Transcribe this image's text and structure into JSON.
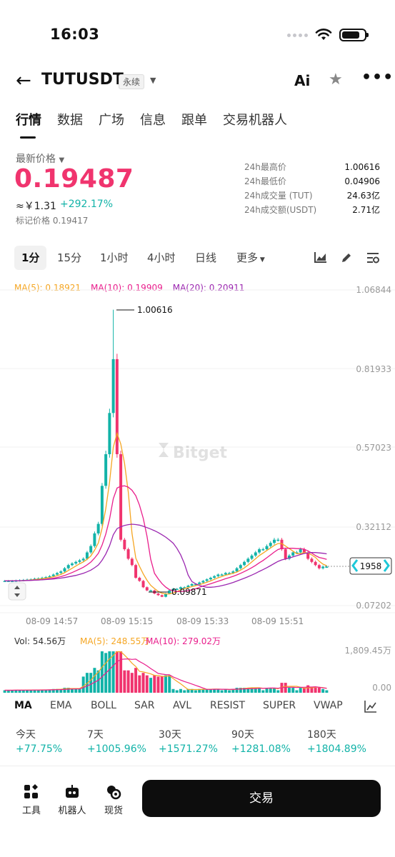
{
  "status": {
    "time": "16:03"
  },
  "header": {
    "pair": "TUTUSDT",
    "badge": "永续",
    "ai_label": "Ai"
  },
  "tabs": [
    "行情",
    "数据",
    "广场",
    "信息",
    "跟单",
    "交易机器人"
  ],
  "ticker": {
    "latest_label": "最新价格",
    "price": "0.19487",
    "cny": "≈￥1.31",
    "change": "+292.17%",
    "mark_price": "标记价格 0.19417"
  },
  "stats": [
    {
      "key": "24h最高价",
      "value": "1.00616"
    },
    {
      "key": "24h最低价",
      "value": "0.04906"
    },
    {
      "key": "24h成交量 (TUT)",
      "value": "24.63亿"
    },
    {
      "key": "24h成交额(USDT)",
      "value": "2.71亿"
    }
  ],
  "periods": [
    "1分",
    "15分",
    "1小时",
    "4小时",
    "日线",
    "更多"
  ],
  "ma_legend": [
    {
      "text": "MA(5): 0.18921",
      "color": "#f5a623"
    },
    {
      "text": "MA(10): 0.19909",
      "color": "#e91e8c"
    },
    {
      "text": "MA(20): 0.20911",
      "color": "#9b27b0"
    }
  ],
  "chart": {
    "y_ticks": [
      "1.06844",
      "0.81933",
      "0.57023",
      "0.32112",
      "0.07202"
    ],
    "x_ticks": [
      "08-09 14:57",
      "08-09 15:15",
      "08-09 15:33",
      "08-09 15:51"
    ],
    "high_label": "1.00616",
    "low_label": "0.09871",
    "current_tag": "1958",
    "watermark": "Bitget",
    "vol_legend": [
      {
        "text": "Vol: 54.56万",
        "color": "#333333"
      },
      {
        "text": "MA(5): 248.55万",
        "color": "#f5a623"
      },
      {
        "text": "MA(10): 279.02万",
        "color": "#e91e8c"
      }
    ],
    "vol_ticks": [
      "1,809.45万",
      "0.00"
    ],
    "up_color": "#12b3a8",
    "down_color": "#f0346e"
  },
  "chart_data": {
    "type": "candlestick",
    "ylim": [
      0.07202,
      1.06844
    ],
    "x_labels": [
      "08-09 14:57",
      "08-09 15:15",
      "08-09 15:33",
      "08-09 15:51"
    ],
    "high": 1.00616,
    "low": 0.09871,
    "last": 0.19487,
    "close": [
      0.15,
      0.15,
      0.15,
      0.151,
      0.152,
      0.153,
      0.154,
      0.155,
      0.157,
      0.158,
      0.16,
      0.162,
      0.165,
      0.17,
      0.175,
      0.18,
      0.19,
      0.2,
      0.205,
      0.21,
      0.215,
      0.22,
      0.24,
      0.26,
      0.3,
      0.33,
      0.45,
      0.55,
      0.68,
      0.85,
      0.55,
      0.28,
      0.25,
      0.22,
      0.2,
      0.16,
      0.15,
      0.13,
      0.12,
      0.12,
      0.11,
      0.105,
      0.1,
      0.11,
      0.12,
      0.125,
      0.125,
      0.13,
      0.13,
      0.135,
      0.14,
      0.14,
      0.145,
      0.15,
      0.155,
      0.16,
      0.165,
      0.17,
      0.17,
      0.175,
      0.175,
      0.18,
      0.19,
      0.2,
      0.21,
      0.22,
      0.23,
      0.24,
      0.25,
      0.25,
      0.26,
      0.27,
      0.28,
      0.28,
      0.25,
      0.22,
      0.23,
      0.24,
      0.24,
      0.25,
      0.24,
      0.22,
      0.21,
      0.2,
      0.19,
      0.195,
      0.195
    ],
    "ma_series": [
      "MA(5)",
      "MA(10)",
      "MA(20)"
    ]
  },
  "indicators": [
    "MA",
    "EMA",
    "BOLL",
    "SAR",
    "AVL",
    "RESIST",
    "SUPER",
    "VWAP"
  ],
  "performance": [
    {
      "label": "今天",
      "value": "+77.75%"
    },
    {
      "label": "7天",
      "value": "+1005.96%"
    },
    {
      "label": "30天",
      "value": "+1571.27%"
    },
    {
      "label": "90天",
      "value": "+1281.08%"
    },
    {
      "label": "180天",
      "value": "+1804.89%"
    }
  ],
  "bottom": {
    "tools": [
      {
        "label": "工具",
        "icon": "tools-icon"
      },
      {
        "label": "机器人",
        "icon": "robot-icon"
      },
      {
        "label": "现货",
        "icon": "spot-icon"
      }
    ],
    "trade": "交易"
  }
}
